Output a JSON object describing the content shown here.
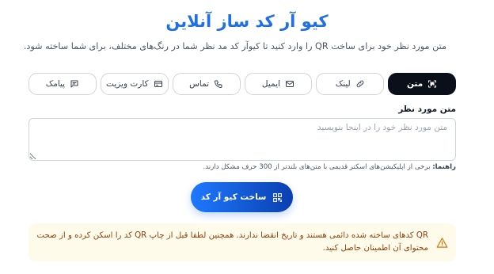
{
  "header": {
    "title": "کیو آر کد ساز آنلاین",
    "subtitle": "متن مورد نظر خود برای ساخت QR را وارد کنید تا کیوآر کد مد نظر شما در رنگ‌های مختلف، برای شما ساخته شود."
  },
  "tabs": [
    {
      "label": "متن",
      "icon": "qr-scan-icon",
      "active": true
    },
    {
      "label": "لینک",
      "icon": "link-icon",
      "active": false
    },
    {
      "label": "ایمیل",
      "icon": "mail-icon",
      "active": false
    },
    {
      "label": "تماس",
      "icon": "phone-icon",
      "active": false
    },
    {
      "label": "کارت ویزیت",
      "icon": "id-card-icon",
      "active": false
    },
    {
      "label": "پیامک",
      "icon": "message-icon",
      "active": false
    }
  ],
  "form": {
    "field_label": "متن مورد نظر",
    "placeholder": "متن مورد نظر خود را در اینجا بنویسید",
    "value": "",
    "hint_prefix": "راهنما:",
    "hint_text": "برخی از اپلیکیشن‌های اسکنر قدیمی با متن‌های بلندتر از 300 حرف مشکل دارند.",
    "submit_label": "ساخت کیو آر کد"
  },
  "notice": {
    "icon": "warning-icon",
    "text": "QR کدهای ساخته شده دائمی هستند و تاریخ انقضا ندارند. همچنین لطفا قبل از چاپ QR کد را اسکن کرده و از صحت محتوای آن اطمینان حاصل کنید."
  },
  "colors": {
    "accent": "#1f6fe5",
    "active_tab": "#0b0f19",
    "button_start": "#1f78ff",
    "button_end": "#0a3fb0",
    "notice_bg": "#fffbeb",
    "notice_text": "#92400e"
  }
}
